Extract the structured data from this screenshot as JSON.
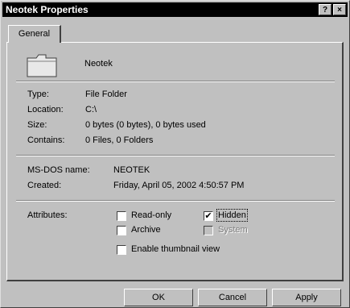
{
  "window": {
    "title": "Neotek Properties",
    "help_label": "?",
    "close_label": "×"
  },
  "tabs": [
    {
      "label": "General"
    }
  ],
  "folder": {
    "name": "Neotek",
    "icon": "folder-icon"
  },
  "info": [
    {
      "label": "Type:",
      "value": "File Folder"
    },
    {
      "label": "Location:",
      "value": "C:\\"
    },
    {
      "label": "Size:",
      "value": "0 bytes (0 bytes), 0 bytes used"
    },
    {
      "label": "Contains:",
      "value": "0 Files, 0 Folders"
    }
  ],
  "dates": [
    {
      "label": "MS-DOS name:",
      "value": "NEOTEK"
    },
    {
      "label": "Created:",
      "value": "Friday, April 05, 2002 4:50:57 PM"
    }
  ],
  "attributes": {
    "label": "Attributes:",
    "read_only": {
      "label": "Read-only",
      "checked": false
    },
    "hidden": {
      "label": "Hidden",
      "checked": true
    },
    "archive": {
      "label": "Archive",
      "checked": false
    },
    "system": {
      "label": "System",
      "checked": false,
      "disabled": true
    }
  },
  "thumbnail": {
    "label": "Enable thumbnail view",
    "checked": false
  },
  "buttons": {
    "ok": "OK",
    "cancel": "Cancel",
    "apply": "Apply"
  },
  "check_glyph": "✔"
}
